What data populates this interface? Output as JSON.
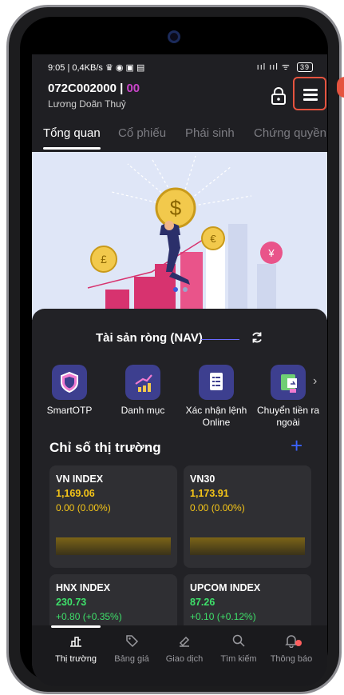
{
  "status_bar": {
    "time": "9:05 | 0,4KB/s",
    "notif_icons": "♛ ◉ ▣ ▤",
    "signal": "ııl ııl ᯤ",
    "battery": "39"
  },
  "account": {
    "id": "072C002000",
    "separator": " | ",
    "sub": "00",
    "name": "Lương Doãn Thuỷ"
  },
  "tabs": [
    {
      "label": "Tổng quan"
    },
    {
      "label": "Cổ phiếu"
    },
    {
      "label": "Phái sinh"
    },
    {
      "label": "Chứng quyền"
    }
  ],
  "nav": {
    "label": "Tài sản ròng (NAV)"
  },
  "quick_actions": [
    {
      "label": "SmartOTP",
      "icon": "shield-icon"
    },
    {
      "label": "Danh mục",
      "icon": "chart-icon"
    },
    {
      "label": "Xác nhận lệnh Online",
      "icon": "document-icon"
    },
    {
      "label": "Chuyển tiền ra ngoài",
      "icon": "transfer-icon"
    }
  ],
  "market": {
    "title": "Chỉ số thị trường",
    "indices": [
      {
        "name": "VN INDEX",
        "value": "1,169.06",
        "change": "0.00 (0.00%)",
        "color": "#f5c518"
      },
      {
        "name": "VN30",
        "value": "1,173.91",
        "change": "0.00 (0.00%)",
        "color": "#f5c518"
      },
      {
        "name": "HNX INDEX",
        "value": "230.73",
        "change": "+0.80 (+0.35%)",
        "color": "#3ee06a"
      },
      {
        "name": "UPCOM INDEX",
        "value": "87.26",
        "change": "+0.10 (+0.12%)",
        "color": "#3ee06a"
      }
    ]
  },
  "bottom_nav": [
    {
      "label": "Thị trường",
      "icon": "market-icon",
      "active": true
    },
    {
      "label": "Bảng giá",
      "icon": "tag-icon",
      "active": false
    },
    {
      "label": "Giao dịch",
      "icon": "trade-icon",
      "active": false
    },
    {
      "label": "Tìm kiếm",
      "icon": "search-icon",
      "active": false
    },
    {
      "label": "Thông báo",
      "icon": "bell-icon",
      "active": false
    }
  ],
  "colors": {
    "accent": "#3b63ff",
    "highlight": "#e5533f",
    "up": "#3ee06a",
    "reference": "#f5c518"
  }
}
